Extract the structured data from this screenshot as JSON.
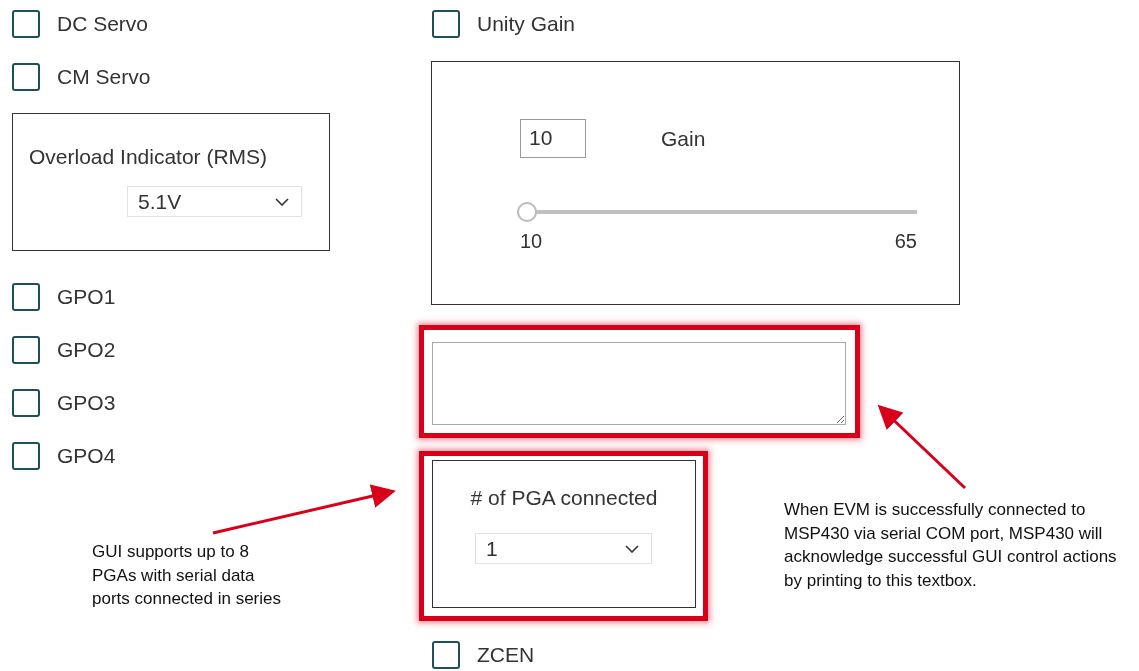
{
  "left_column": {
    "top_checkboxes": [
      {
        "label": "DC Servo",
        "checked": false
      },
      {
        "label": "CM Servo",
        "checked": false
      }
    ],
    "overload_indicator": {
      "label": "Overload Indicator (RMS)",
      "value": "5.1V"
    },
    "gpo_checkboxes": [
      {
        "label": "GPO1",
        "checked": false
      },
      {
        "label": "GPO2",
        "checked": false
      },
      {
        "label": "GPO3",
        "checked": false
      },
      {
        "label": "GPO4",
        "checked": false
      }
    ]
  },
  "right_column": {
    "unity_gain": {
      "label": "Unity Gain",
      "checked": false
    },
    "gain_panel": {
      "value": "10",
      "label": "Gain",
      "slider": {
        "level": 0,
        "min_label": "10",
        "max_label": "65"
      }
    },
    "response_textbox": {
      "highlighted": true
    },
    "pga_panel": {
      "label": "# of PGA connected",
      "value": "1",
      "highlighted": true
    },
    "zcen": {
      "label": "ZCEN",
      "checked": false
    }
  },
  "annotations": [
    {
      "text": "GUI supports up to 8 PGAs with serial data ports connected in series"
    },
    {
      "text": "When EVM is successfully connected to MSP430 via serial COM port, MSP430 will acknowledge successful GUI control actions by printing to this textbox."
    }
  ]
}
